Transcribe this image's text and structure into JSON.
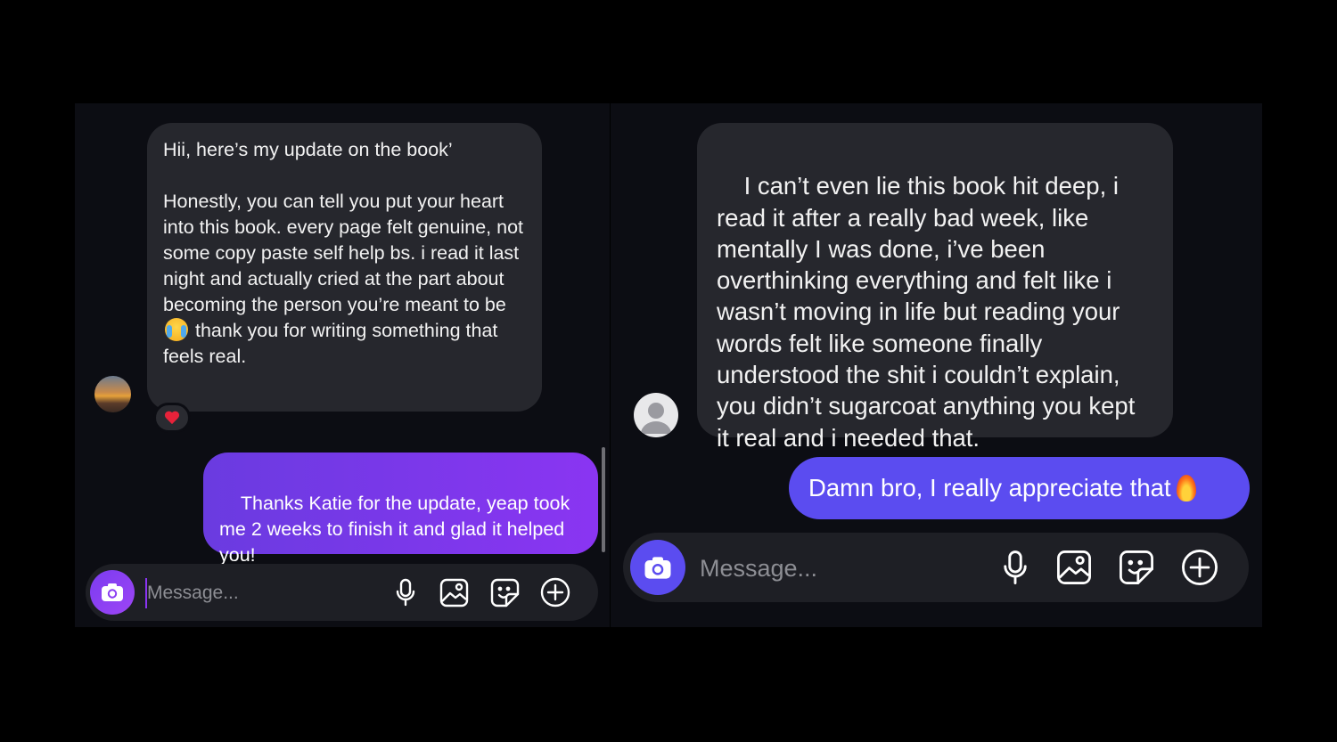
{
  "left": {
    "incoming": {
      "first_line": "Hii, here’s my update on the book’",
      "body_before_emoji": "Honestly, you can tell you put your heart into this book. every page felt genuine, not some copy paste self help bs. i read it last night and actually cried at the part about becoming the person you’re meant to be",
      "body_after_emoji": " thank you for writing something that feels real.",
      "emoji": "loudly-crying-face",
      "reaction": "red-heart"
    },
    "outgoing": {
      "text": "Thanks Katie for the update, yeap took me 2 weeks to finish it and glad it helped you!"
    },
    "composer": {
      "placeholder": "Message..."
    },
    "colors": {
      "outgoing": "#8a35f2",
      "incoming": "#26272d"
    }
  },
  "right": {
    "incoming": {
      "text": "I can’t even lie this book hit deep, i read it after a really bad week, like mentally I was done, i’ve been overthinking everything and felt like i wasn’t moving in life but reading your words felt like someone finally understood the shit i couldn’t explain, you didn’t sugarcoat anything you kept it real and i needed that."
    },
    "outgoing": {
      "text": "Damn bro, I really appreciate that",
      "emoji": "fire"
    },
    "composer": {
      "placeholder": "Message..."
    },
    "colors": {
      "outgoing": "#5b4cf0",
      "incoming": "#26272d"
    }
  },
  "icons": [
    "camera-icon",
    "microphone-icon",
    "gallery-icon",
    "sticker-icon",
    "plus-circle-icon"
  ]
}
